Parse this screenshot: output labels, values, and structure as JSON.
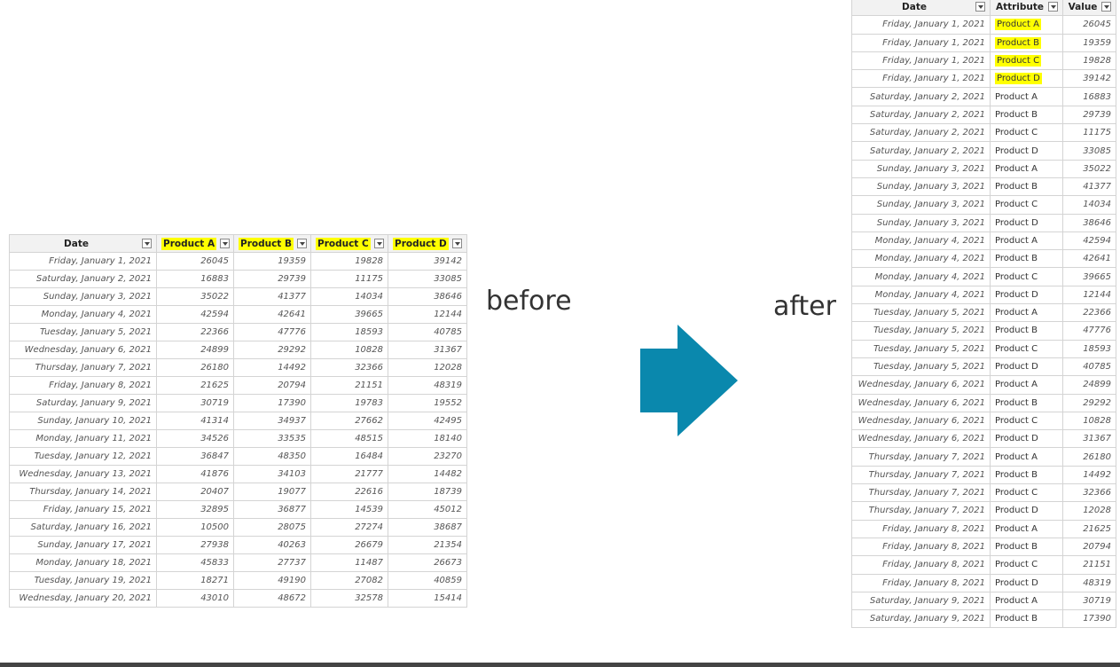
{
  "colors": {
    "highlight": "#ffff00",
    "arrow": "#0a88ad",
    "grid": "#d4d4d4"
  },
  "icons": {
    "dropdown": "dropdown-caret-icon",
    "arrow": "right-arrow-icon"
  },
  "labels": {
    "before": "before",
    "after": "after"
  },
  "before_table": {
    "headers": [
      "Date",
      "Product A",
      "Product B",
      "Product C",
      "Product D"
    ],
    "rows": [
      [
        "Friday, January 1, 2021",
        "26045",
        "19359",
        "19828",
        "39142"
      ],
      [
        "Saturday, January 2, 2021",
        "16883",
        "29739",
        "11175",
        "33085"
      ],
      [
        "Sunday, January 3, 2021",
        "35022",
        "41377",
        "14034",
        "38646"
      ],
      [
        "Monday, January 4, 2021",
        "42594",
        "42641",
        "39665",
        "12144"
      ],
      [
        "Tuesday, January 5, 2021",
        "22366",
        "47776",
        "18593",
        "40785"
      ],
      [
        "Wednesday, January 6, 2021",
        "24899",
        "29292",
        "10828",
        "31367"
      ],
      [
        "Thursday, January 7, 2021",
        "26180",
        "14492",
        "32366",
        "12028"
      ],
      [
        "Friday, January 8, 2021",
        "21625",
        "20794",
        "21151",
        "48319"
      ],
      [
        "Saturday, January 9, 2021",
        "30719",
        "17390",
        "19783",
        "19552"
      ],
      [
        "Sunday, January 10, 2021",
        "41314",
        "34937",
        "27662",
        "42495"
      ],
      [
        "Monday, January 11, 2021",
        "34526",
        "33535",
        "48515",
        "18140"
      ],
      [
        "Tuesday, January 12, 2021",
        "36847",
        "48350",
        "16484",
        "23270"
      ],
      [
        "Wednesday, January 13, 2021",
        "41876",
        "34103",
        "21777",
        "14482"
      ],
      [
        "Thursday, January 14, 2021",
        "20407",
        "19077",
        "22616",
        "18739"
      ],
      [
        "Friday, January 15, 2021",
        "32895",
        "36877",
        "14539",
        "45012"
      ],
      [
        "Saturday, January 16, 2021",
        "10500",
        "28075",
        "27274",
        "38687"
      ],
      [
        "Sunday, January 17, 2021",
        "27938",
        "40263",
        "26679",
        "21354"
      ],
      [
        "Monday, January 18, 2021",
        "45833",
        "27737",
        "11487",
        "26673"
      ],
      [
        "Tuesday, January 19, 2021",
        "18271",
        "49190",
        "27082",
        "40859"
      ],
      [
        "Wednesday, January 20, 2021",
        "43010",
        "48672",
        "32578",
        "15414"
      ]
    ]
  },
  "after_table": {
    "headers": [
      "Date",
      "Attribute",
      "Value"
    ],
    "rows": [
      [
        "Friday, January 1, 2021",
        "Product A",
        "26045"
      ],
      [
        "Friday, January 1, 2021",
        "Product B",
        "19359"
      ],
      [
        "Friday, January 1, 2021",
        "Product C",
        "19828"
      ],
      [
        "Friday, January 1, 2021",
        "Product D",
        "39142"
      ],
      [
        "Saturday, January 2, 2021",
        "Product A",
        "16883"
      ],
      [
        "Saturday, January 2, 2021",
        "Product B",
        "29739"
      ],
      [
        "Saturday, January 2, 2021",
        "Product C",
        "11175"
      ],
      [
        "Saturday, January 2, 2021",
        "Product D",
        "33085"
      ],
      [
        "Sunday, January 3, 2021",
        "Product A",
        "35022"
      ],
      [
        "Sunday, January 3, 2021",
        "Product B",
        "41377"
      ],
      [
        "Sunday, January 3, 2021",
        "Product C",
        "14034"
      ],
      [
        "Sunday, January 3, 2021",
        "Product D",
        "38646"
      ],
      [
        "Monday, January 4, 2021",
        "Product A",
        "42594"
      ],
      [
        "Monday, January 4, 2021",
        "Product B",
        "42641"
      ],
      [
        "Monday, January 4, 2021",
        "Product C",
        "39665"
      ],
      [
        "Monday, January 4, 2021",
        "Product D",
        "12144"
      ],
      [
        "Tuesday, January 5, 2021",
        "Product A",
        "22366"
      ],
      [
        "Tuesday, January 5, 2021",
        "Product B",
        "47776"
      ],
      [
        "Tuesday, January 5, 2021",
        "Product C",
        "18593"
      ],
      [
        "Tuesday, January 5, 2021",
        "Product D",
        "40785"
      ],
      [
        "Wednesday, January 6, 2021",
        "Product A",
        "24899"
      ],
      [
        "Wednesday, January 6, 2021",
        "Product B",
        "29292"
      ],
      [
        "Wednesday, January 6, 2021",
        "Product C",
        "10828"
      ],
      [
        "Wednesday, January 6, 2021",
        "Product D",
        "31367"
      ],
      [
        "Thursday, January 7, 2021",
        "Product A",
        "26180"
      ],
      [
        "Thursday, January 7, 2021",
        "Product B",
        "14492"
      ],
      [
        "Thursday, January 7, 2021",
        "Product C",
        "32366"
      ],
      [
        "Thursday, January 7, 2021",
        "Product D",
        "12028"
      ],
      [
        "Friday, January 8, 2021",
        "Product A",
        "21625"
      ],
      [
        "Friday, January 8, 2021",
        "Product B",
        "20794"
      ],
      [
        "Friday, January 8, 2021",
        "Product C",
        "21151"
      ],
      [
        "Friday, January 8, 2021",
        "Product D",
        "48319"
      ],
      [
        "Saturday, January 9, 2021",
        "Product A",
        "30719"
      ],
      [
        "Saturday, January 9, 2021",
        "Product B",
        "17390"
      ]
    ]
  }
}
